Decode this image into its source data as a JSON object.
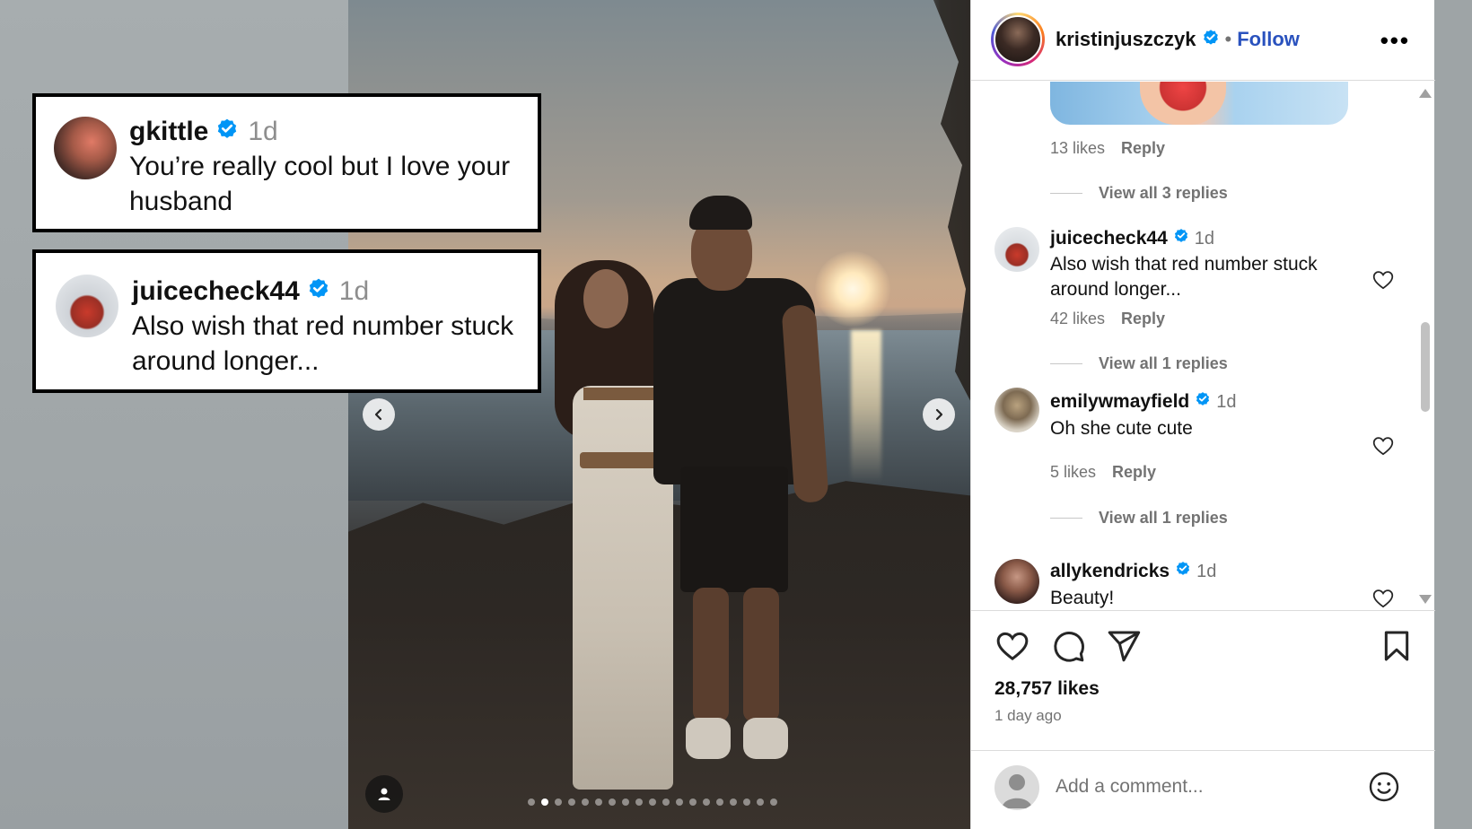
{
  "overlay_cards": [
    {
      "username": "gkittle",
      "time": "1d",
      "text": "You’re really cool but I love your husband"
    },
    {
      "username": "juicecheck44",
      "time": "1d",
      "text": "Also wish that red number stuck around longer..."
    }
  ],
  "post": {
    "username": "kristinjuszczyk",
    "follow_label": "Follow",
    "separator": "•",
    "more_label": "•••",
    "carousel": {
      "total": 19,
      "active_index": 1
    }
  },
  "comments": {
    "top_reply_meta": {
      "likes": "13 likes",
      "reply": "Reply"
    },
    "top_view_all": "View all 3 replies",
    "items": [
      {
        "username": "juicecheck44",
        "time": "1d",
        "text": "Also wish that red number stuck around longer...",
        "likes": "42 likes",
        "reply": "Reply",
        "view_all": "View all 1 replies"
      },
      {
        "username": "emilywmayfield",
        "time": "1d",
        "text": "Oh she cute cute",
        "likes": "5 likes",
        "reply": "Reply",
        "view_all": "View all 1 replies"
      },
      {
        "username": "allykendricks",
        "time": "1d",
        "text": "Beauty!"
      }
    ]
  },
  "footer": {
    "likes_count": "28,757 likes",
    "posted_ago": "1 day ago",
    "comment_placeholder": "Add a comment..."
  },
  "colors": {
    "verified": "#0095f6",
    "follow": "#2a52be",
    "muted": "#737373"
  }
}
